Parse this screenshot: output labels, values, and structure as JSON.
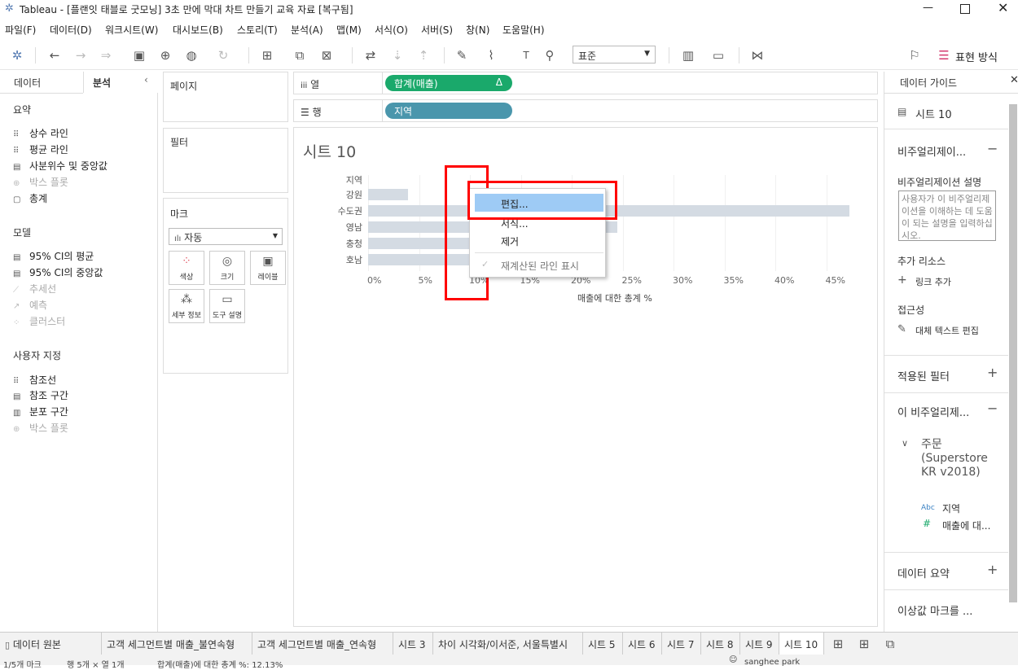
{
  "window": {
    "title": "Tableau - [플랜잇 태블로 굿모닝] 3초 만에 막대 차트 만들기 교육 자료 [복구됨]"
  },
  "menu": [
    "파일(F)",
    "데이터(D)",
    "워크시트(W)",
    "대시보드(B)",
    "스토리(T)",
    "분석(A)",
    "맵(M)",
    "서식(O)",
    "서버(S)",
    "창(N)",
    "도움말(H)"
  ],
  "toolbar": {
    "fit_value": "표준",
    "show_me": "표현 방식"
  },
  "left_pane": {
    "tab_data": "데이터",
    "tab_analysis": "분석",
    "summary_h": "요약",
    "summary": [
      "상수 라인",
      "평균 라인",
      "사분위수 및 중앙값",
      "박스 플롯",
      "총계"
    ],
    "model_h": "모델",
    "model": [
      "95% CI의 평균",
      "95% CI의 중앙값",
      "추세선",
      "예측",
      "클러스터"
    ],
    "custom_h": "사용자 지정",
    "custom": [
      "참조선",
      "참조 구간",
      "분포 구간",
      "박스 플롯"
    ]
  },
  "cards": {
    "pages": "페이지",
    "filters": "필터",
    "marks": "마크",
    "mark_type": "자동",
    "mark_buttons": [
      "색상",
      "크기",
      "레이블",
      "세부 정보",
      "도구 설명"
    ]
  },
  "shelves": {
    "columns_label": "열",
    "columns_pill": "합계(매출)",
    "columns_delta": "Δ",
    "rows_label": "행",
    "rows_pill": "지역"
  },
  "viz": {
    "sheet_title": "시트 10"
  },
  "chart_data": {
    "type": "bar",
    "orientation": "horizontal",
    "row_header": "지역",
    "categories": [
      "강원",
      "수도권",
      "영남",
      "충청",
      "호남"
    ],
    "values": [
      3.9,
      47.3,
      24.5,
      10.1,
      10.0
    ],
    "x_ticks": [
      "0%",
      "5%",
      "10%",
      "15%",
      "20%",
      "25%",
      "30%",
      "35%",
      "40%",
      "45%"
    ],
    "xlim": [
      0,
      50
    ],
    "xlabel": "매출에 대한 총계 %",
    "bar_color": "#d4dbe3"
  },
  "context_menu": {
    "items": [
      "편집...",
      "서식...",
      "제거",
      "재계산된 라인 표시"
    ]
  },
  "right_pane": {
    "title": "데이터 가이드",
    "sheet": "시트 10",
    "viz_section": "비주얼리제이...",
    "viz_desc_label": "비주얼리제이션 설명",
    "viz_desc_placeholder": "사용자가 이 비주얼리제이션을 이해하는 데 도움이 되는 설명을 입력하십시오.",
    "resources": "추가 리소스",
    "add_link": "링크 추가",
    "accessibility": "접근성",
    "alt_text": "대체 텍스트 편집",
    "applied_filters": "적용된 필터",
    "this_viz": "이 비주얼리제...",
    "datasource": "주문 (Superstore KR v2018)",
    "field1_type": "Abc",
    "field1": "지역",
    "field2_type": "#",
    "field2": "매출에 대...",
    "data_summary": "데이터 요약",
    "outliers": "이상값 마크를 ..."
  },
  "tabs": [
    "데이터 원본",
    "고객 세그먼트별 매출_불연속형",
    "고객 세그먼트별 매출_연속형",
    "시트 3",
    "차이 시각화/이서준, 서울특별시",
    "시트 5",
    "시트 6",
    "시트 7",
    "시트 8",
    "시트 9",
    "시트 10"
  ],
  "status": {
    "left": "1/5개 마크",
    "rows": "행 5개 × 열 1개",
    "sum": "합계(매출)에 대한 총계 %: 12.13%",
    "user": "sanghee park"
  },
  "colors": {
    "green_pill": "#1aa96b",
    "blue_pill": "#4a96ac",
    "highlight": "#9ecbf5",
    "annotation": "#ff0000"
  }
}
